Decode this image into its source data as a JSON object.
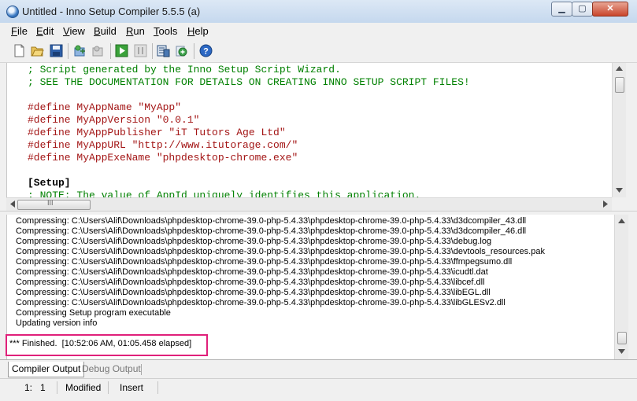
{
  "window": {
    "title": "Untitled - Inno Setup Compiler 5.5.5 (a)",
    "controls": {
      "minimize": "▁",
      "maximize": "▢",
      "close": "✕"
    }
  },
  "menu": [
    {
      "label": "File",
      "accel": "F",
      "rest": "ile"
    },
    {
      "label": "Edit",
      "accel": "E",
      "rest": "dit"
    },
    {
      "label": "View",
      "accel": "V",
      "rest": "iew"
    },
    {
      "label": "Build",
      "accel": "B",
      "rest": "uild"
    },
    {
      "label": "Run",
      "accel": "R",
      "rest": "un"
    },
    {
      "label": "Tools",
      "accel": "T",
      "rest": "ools"
    },
    {
      "label": "Help",
      "accel": "H",
      "rest": "elp"
    }
  ],
  "toolbar": {
    "icons": [
      "new-file-icon",
      "open-folder-icon",
      "save-icon",
      "compile-icon",
      "stop-compile-icon",
      "run-icon",
      "pause-icon",
      "target-setup-icon",
      "target-uninstall-icon",
      "help-icon"
    ]
  },
  "editor": {
    "lines": [
      {
        "text": "; Script generated by the Inno Setup Script Wizard.",
        "kind": "comment"
      },
      {
        "text": "; SEE THE DOCUMENTATION FOR DETAILS ON CREATING INNO SETUP SCRIPT FILES!",
        "kind": "comment"
      },
      {
        "text": "",
        "kind": "blank"
      },
      {
        "text": "#define MyAppName \"MyApp\"",
        "kind": "define"
      },
      {
        "text": "#define MyAppVersion \"0.0.1\"",
        "kind": "define"
      },
      {
        "text": "#define MyAppPublisher \"iT Tutors Age Ltd\"",
        "kind": "define"
      },
      {
        "text": "#define MyAppURL \"http://www.itutorage.com/\"",
        "kind": "define"
      },
      {
        "text": "#define MyAppExeName \"phpdesktop-chrome.exe\"",
        "kind": "define"
      },
      {
        "text": "",
        "kind": "blank"
      },
      {
        "text": "[Setup]",
        "kind": "section"
      },
      {
        "text": "; NOTE: The value of AppId uniquely identifies this application.",
        "kind": "comment"
      }
    ]
  },
  "output": {
    "lines": [
      "Compressing: C:\\Users\\Alif\\Downloads\\phpdesktop-chrome-39.0-php-5.4.33\\phpdesktop-chrome-39.0-php-5.4.33\\d3dcompiler_43.dll",
      "Compressing: C:\\Users\\Alif\\Downloads\\phpdesktop-chrome-39.0-php-5.4.33\\phpdesktop-chrome-39.0-php-5.4.33\\d3dcompiler_46.dll",
      "Compressing: C:\\Users\\Alif\\Downloads\\phpdesktop-chrome-39.0-php-5.4.33\\phpdesktop-chrome-39.0-php-5.4.33\\debug.log",
      "Compressing: C:\\Users\\Alif\\Downloads\\phpdesktop-chrome-39.0-php-5.4.33\\phpdesktop-chrome-39.0-php-5.4.33\\devtools_resources.pak",
      "Compressing: C:\\Users\\Alif\\Downloads\\phpdesktop-chrome-39.0-php-5.4.33\\phpdesktop-chrome-39.0-php-5.4.33\\ffmpegsumo.dll",
      "Compressing: C:\\Users\\Alif\\Downloads\\phpdesktop-chrome-39.0-php-5.4.33\\phpdesktop-chrome-39.0-php-5.4.33\\icudtl.dat",
      "Compressing: C:\\Users\\Alif\\Downloads\\phpdesktop-chrome-39.0-php-5.4.33\\phpdesktop-chrome-39.0-php-5.4.33\\libcef.dll",
      "Compressing: C:\\Users\\Alif\\Downloads\\phpdesktop-chrome-39.0-php-5.4.33\\phpdesktop-chrome-39.0-php-5.4.33\\libEGL.dll",
      "Compressing: C:\\Users\\Alif\\Downloads\\phpdesktop-chrome-39.0-php-5.4.33\\phpdesktop-chrome-39.0-php-5.4.33\\libGLESv2.dll",
      "Compressing Setup program executable",
      "Updating version info"
    ],
    "finished": "*** Finished.  [10:52:06 AM, 01:05.458 elapsed]",
    "highlight_color": "#e0207a"
  },
  "tabs": [
    {
      "label": "Compiler Output",
      "active": true
    },
    {
      "label": "Debug Output",
      "active": false
    }
  ],
  "status": {
    "position": "1:   1",
    "modified": "Modified",
    "mode": "Insert"
  },
  "scrollbar": {
    "thumb_grip": "III"
  }
}
